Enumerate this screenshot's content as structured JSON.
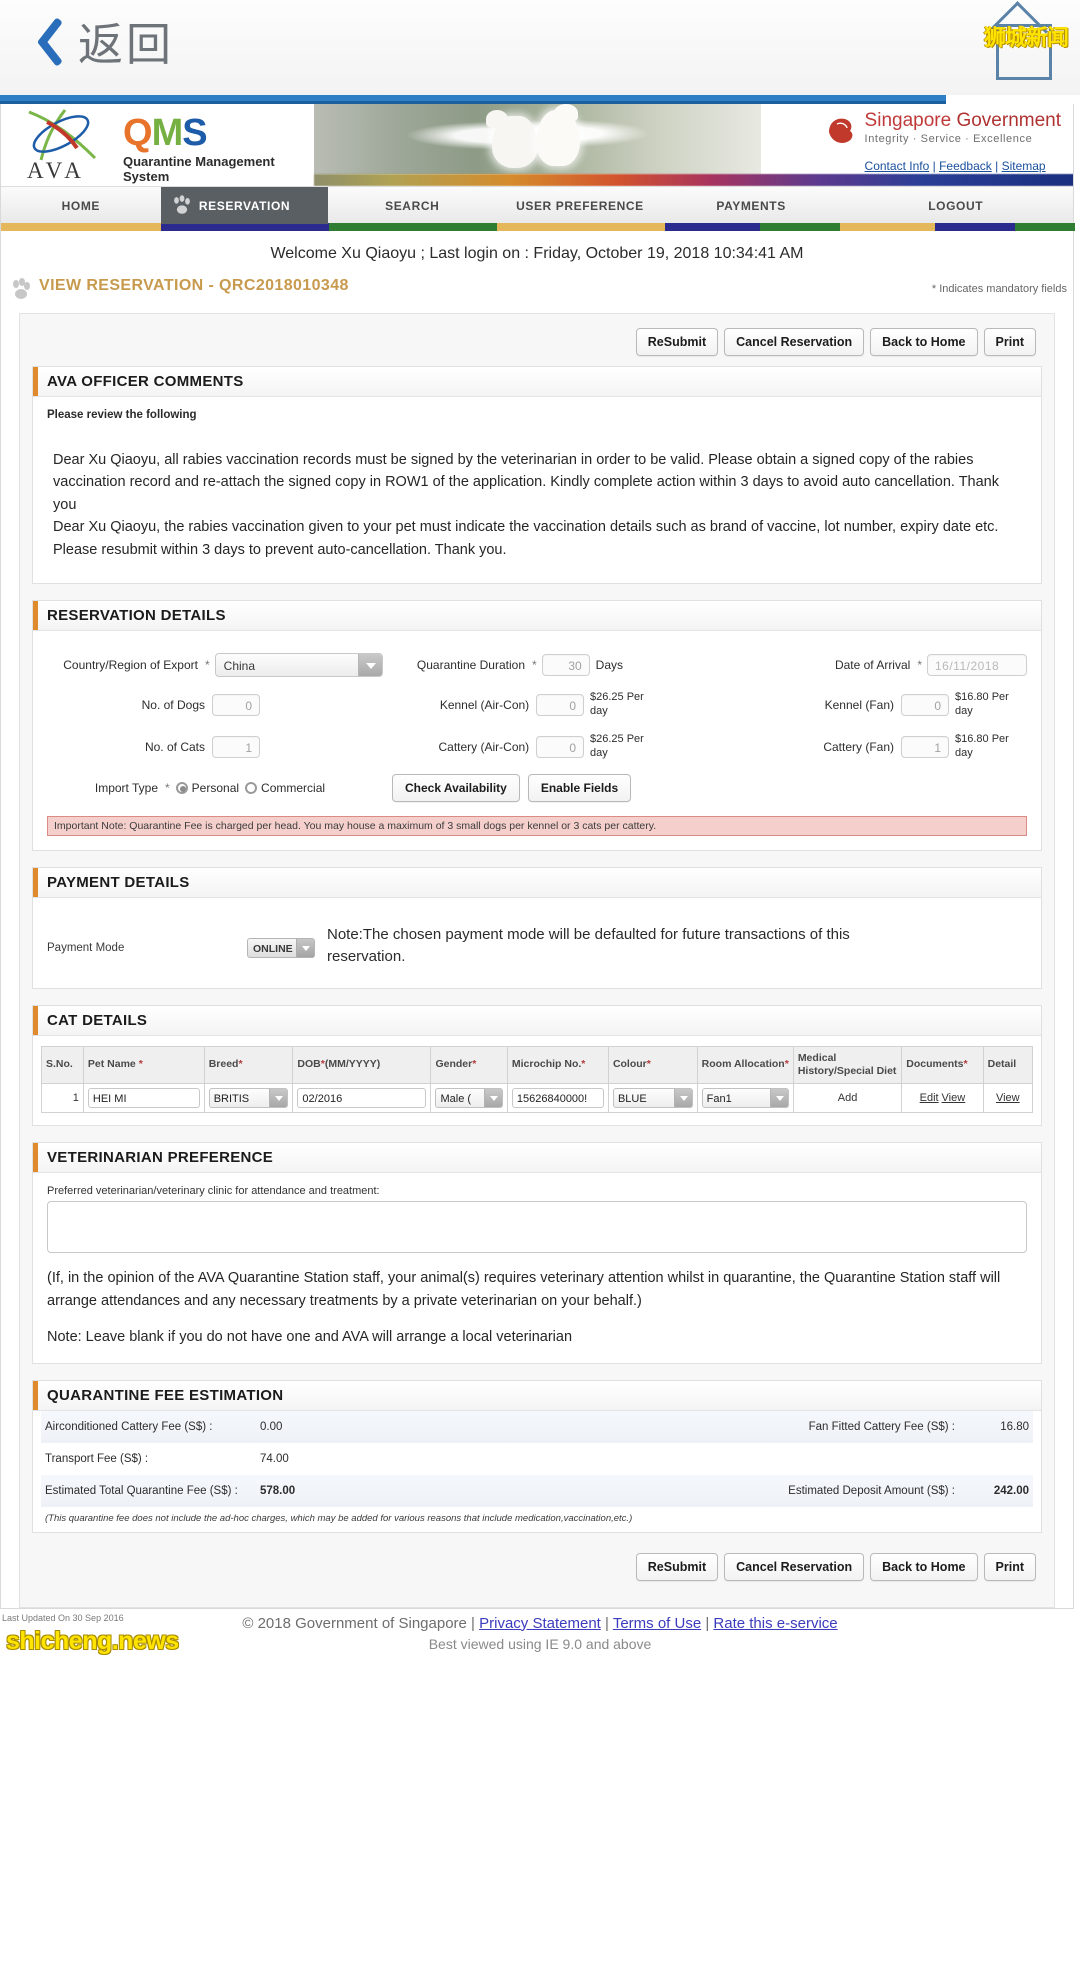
{
  "mobile_bar": {
    "back_label": "返回",
    "watermark": "狮城新闻"
  },
  "site_header": {
    "logo_word": "AVA",
    "qms_letters": [
      "Q",
      "M",
      "S"
    ],
    "qms_subtitle": "Quarantine Management System",
    "gov_title_plain": "Singapore ",
    "gov_title_accent": "Government",
    "gov_tagline": "Integrity  ·  Service  ·  Excellence",
    "links": [
      "Contact Info",
      "Feedback",
      "Sitemap"
    ]
  },
  "nav": {
    "items": [
      {
        "label": "HOME",
        "active": false
      },
      {
        "label": "RESERVATION",
        "active": true
      },
      {
        "label": "SEARCH",
        "active": false
      },
      {
        "label": "USER PREFERENCE",
        "active": false
      },
      {
        "label": "PAYMENTS",
        "active": false
      },
      {
        "label": "LOGOUT",
        "active": false
      }
    ]
  },
  "welcome": "Welcome Xu Qiaoyu ; Last login on : Friday, October 19, 2018 10:34:41 AM",
  "page": {
    "title": "VIEW RESERVATION - QRC2018010348",
    "mandatory_note": "* Indicates mandatory fields"
  },
  "action_buttons": [
    "ReSubmit",
    "Cancel Reservation",
    "Back to Home",
    "Print"
  ],
  "officer_comments": {
    "heading": "AVA OFFICER COMMENTS",
    "lead": "Please review the following",
    "paragraphs": [
      "Dear Xu Qiaoyu, all rabies vaccination records must be signed by the veterinarian in order to be valid. Please obtain a signed copy of the rabies vaccination record and re-attach the signed copy in ROW1 of the application. Kindly complete action within 3 days to avoid auto cancellation. Thank you",
      "Dear Xu Qiaoyu, the rabies vaccination given to your pet must indicate the vaccination details such as brand of vaccine, lot number, expiry date etc. Please resubmit within 3 days to prevent auto-cancellation. Thank you."
    ]
  },
  "reservation": {
    "heading": "RESERVATION DETAILS",
    "country_label": "Country/Region of Export",
    "country_value": "China",
    "dogs_label": "No. of Dogs",
    "dogs_value": "0",
    "cats_label": "No. of Cats",
    "cats_value": "1",
    "import_type_label": "Import Type",
    "import_personal": "Personal",
    "import_commercial": "Commercial",
    "duration_label": "Quarantine Duration",
    "duration_value": "30",
    "duration_unit": "Days",
    "kennel_ac_label": "Kennel (Air-Con)",
    "kennel_ac_value": "0",
    "kennel_ac_price": "$26.25 Per day",
    "cattery_ac_label": "Cattery (Air-Con)",
    "cattery_ac_value": "0",
    "cattery_ac_price": "$26.25 Per day",
    "arrival_label": "Date of Arrival",
    "arrival_value": "16/11/2018",
    "kennel_fan_label": "Kennel (Fan)",
    "kennel_fan_value": "0",
    "kennel_fan_price": "$16.80 Per day",
    "cattery_fan_label": "Cattery (Fan)",
    "cattery_fan_value": "1",
    "cattery_fan_price": "$16.80 Per day",
    "check_availability": "Check Availability",
    "enable_fields": "Enable Fields",
    "important_note": "Important Note: Quarantine Fee is charged per head. You may house a maximum of 3 small dogs per kennel or 3 cats per cattery."
  },
  "payment": {
    "heading": "PAYMENT DETAILS",
    "mode_label": "Payment Mode",
    "mode_value": "ONLINE",
    "note": "Note:The chosen payment mode will be defaulted for future transactions of this reservation."
  },
  "cat_details": {
    "heading": "CAT DETAILS",
    "columns": [
      "S.No.",
      "Pet Name *",
      "Breed*",
      "DOB*(MM/YYYY)",
      "Gender*",
      "Microchip No.*",
      "Colour*",
      "Room Allocation*",
      "Medical History/Special Diet",
      "Documents*",
      "Detail"
    ],
    "rows": [
      {
        "sno": "1",
        "pet_name": "HEI MI",
        "breed": "BRITIS",
        "dob": "02/2016",
        "gender": "Male (",
        "microchip": "15626840000!",
        "colour": "BLUE",
        "room": "Fan1",
        "medical": "Add",
        "documents_edit": "Edit",
        "documents_view": "View",
        "detail": "View"
      }
    ]
  },
  "vet": {
    "heading": "VETERINARIAN PREFERENCE",
    "label": "Preferred veterinarian/veterinary clinic for attendance and treatment:",
    "textarea_value": "",
    "paragraph": "(If, in the opinion of the AVA Quarantine Station staff, your animal(s) requires veterinary attention whilst in quarantine, the Quarantine Station staff will arrange attendances and any necessary treatments by a private veterinarian on your behalf.)",
    "note": "Note: Leave blank if you do not have one and AVA will arrange a local veterinarian"
  },
  "fees": {
    "heading": "QUARANTINE FEE ESTIMATION",
    "rows_left": [
      {
        "label": "Airconditioned Cattery Fee (S$) :",
        "value": "0.00",
        "bold": false
      },
      {
        "label": "Transport Fee (S$) :",
        "value": "74.00",
        "bold": false
      },
      {
        "label": "Estimated Total Quarantine Fee (S$) :",
        "value": "578.00",
        "bold": true
      }
    ],
    "rows_right": [
      {
        "label": "Fan Fitted Cattery Fee (S$) :",
        "value": "16.80",
        "bold": false
      },
      {
        "label": "",
        "value": "",
        "bold": false
      },
      {
        "label": "Estimated Deposit Amount (S$) :",
        "value": "242.00",
        "bold": true
      }
    ],
    "footnote": "(This quarantine fee does not include the ad-hoc charges, which may be added for various reasons that include medication,vaccination,etc.)"
  },
  "footer": {
    "copyright": "© 2018 Government of Singapore |",
    "links": [
      "Privacy Statement",
      "Terms of Use",
      "Rate this e-service"
    ],
    "best_viewed": "Best viewed using IE 9.0 and above",
    "last_updated": "Last Updated On  30 Sep 2016",
    "watermark": "shicheng.news"
  }
}
